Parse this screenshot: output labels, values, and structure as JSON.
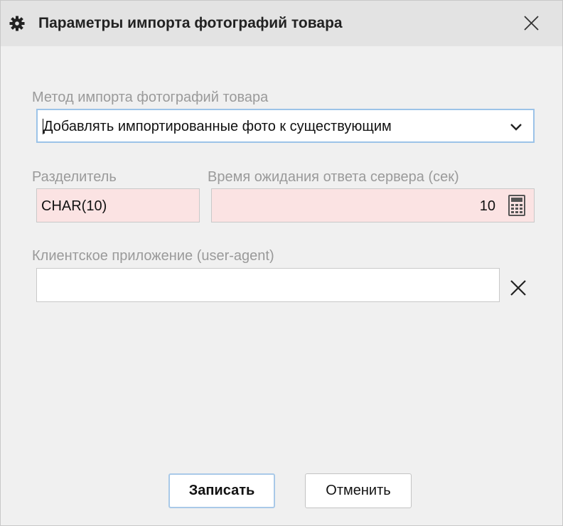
{
  "dialog": {
    "title": "Параметры импорта фотографий товара",
    "title_icon": "gear-icon",
    "close_icon": "close-icon"
  },
  "import_method": {
    "label": "Метод импорта фотографий товара",
    "value": "Добавлять импортированные фото к существующим"
  },
  "separator": {
    "label": "Разделитель",
    "value": "CHAR(10)"
  },
  "server_timeout": {
    "label": "Время ожидания ответа сервера (сек)",
    "value": "10"
  },
  "user_agent": {
    "label": "Клиентское приложение (user-agent)",
    "value": ""
  },
  "buttons": {
    "save": "Записать",
    "cancel": "Отменить"
  },
  "colors": {
    "required_field_bg": "#fbe3e3",
    "focus_border": "#9cc3e8",
    "titlebar_bg": "#e3e3e3"
  }
}
